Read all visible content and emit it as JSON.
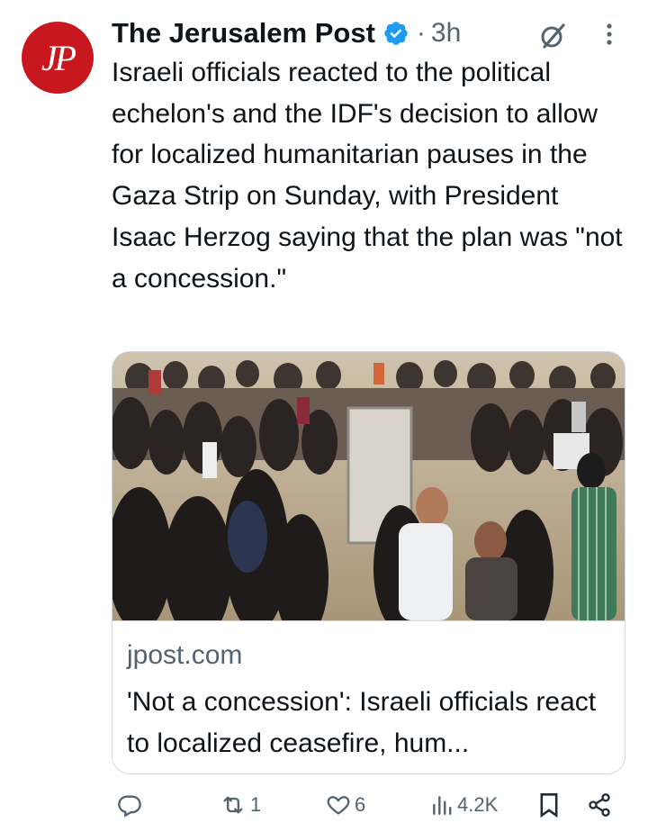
{
  "tweet": {
    "author_name": "The Jerusalem Post",
    "avatar_text": "JP",
    "separator": "·",
    "timestamp": "3h",
    "text": "Israeli officials reacted to the political echelon's and the IDF's decision to allow for localized humanitarian pauses in the Gaza Strip on Sunday, with President Isaac Herzog saying that the plan was \"not a concession.\""
  },
  "card": {
    "domain": "jpost.com",
    "title": "'Not a concession': Israeli officials react to localized ceasefire, hum..."
  },
  "actions": {
    "replies": "",
    "reposts": "1",
    "likes": "6",
    "views": "4.2K"
  },
  "colors": {
    "brand_red": "#c8171e",
    "verified_blue": "#1d9bf0",
    "secondary_text": "#536471"
  },
  "icons": [
    "verified-badge-icon",
    "grok-icon",
    "more-options-icon",
    "reply-icon",
    "repost-icon",
    "like-icon",
    "views-icon",
    "bookmark-icon",
    "share-icon"
  ]
}
